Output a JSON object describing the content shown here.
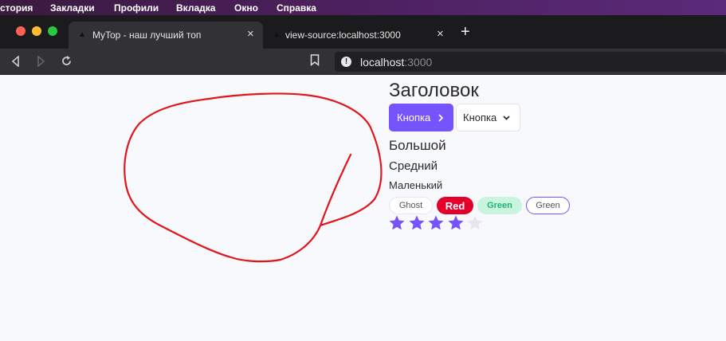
{
  "menubar": {
    "items": [
      "стория",
      "Закладки",
      "Профили",
      "Вкладка",
      "Окно",
      "Справка"
    ]
  },
  "tabs": [
    {
      "title": "MyTop - наш лучший топ",
      "active": true
    },
    {
      "title": "view-source:localhost:3000",
      "active": false
    }
  ],
  "address": {
    "host": "localhost",
    "port": ":3000"
  },
  "page": {
    "heading": "Заголовок",
    "primary_button": "Кнопка",
    "ghost_button": "Кнопка",
    "p_large": "Большой",
    "p_medium": "Средний",
    "p_small": "Маленький",
    "tags": {
      "ghost": "Ghost",
      "red": "Red",
      "green": "Green",
      "green_outline": "Green"
    },
    "rating": {
      "value": 4,
      "max": 5
    }
  },
  "colors": {
    "primary": "#7653fc",
    "red": "#e4002b",
    "green_bg": "#c9f4de",
    "green_text": "#1db37a",
    "star_filled": "#7653fc",
    "star_empty": "#e6e6ec",
    "scribble": "#e0161b"
  }
}
